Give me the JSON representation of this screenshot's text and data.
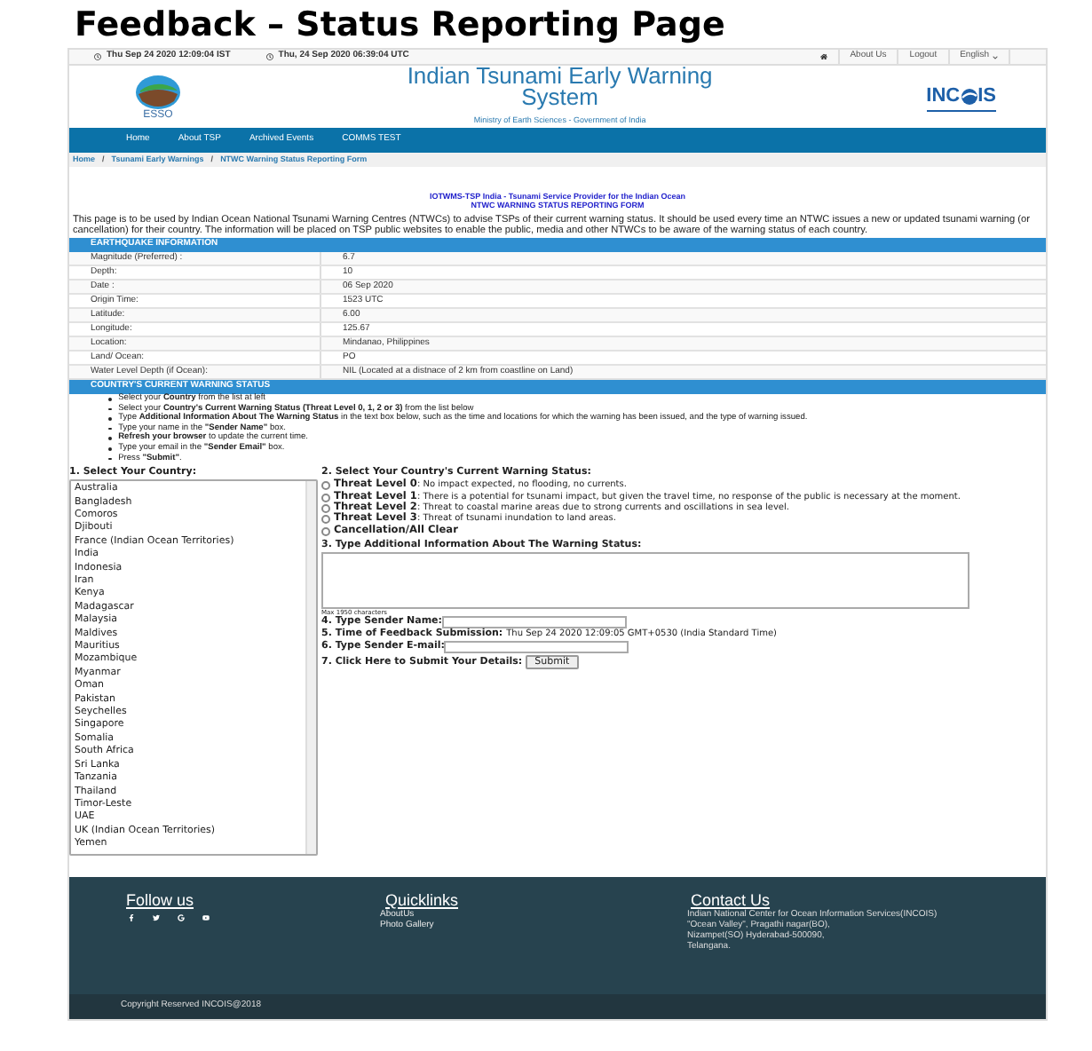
{
  "slide_title": "Feedback – Status Reporting Page",
  "top_bar": {
    "local_time": "Thu Sep 24 2020 12:09:04 IST",
    "utc_time": "Thu, 24 Sep 2020 06:39:04 UTC",
    "links": [
      "About Us",
      "Logout"
    ],
    "language": "English"
  },
  "header": {
    "left_logo_label": "ESSO",
    "title": "Indian Tsunami Early Warning System",
    "subtitle": "Ministry of Earth Sciences - Government of India",
    "right_logo_start": "INC",
    "right_logo_end": "IS"
  },
  "nav": [
    "Home",
    "About TSP",
    "Archived Events",
    "COMMS TEST"
  ],
  "breadcrumb": [
    {
      "label": "Home"
    },
    {
      "separator": "/",
      "label": "Tsunami Early Warnings"
    },
    {
      "separator": "/",
      "label": "NTWC Warning Status Reporting Form"
    }
  ],
  "form_heading": [
    "IOTWMS-TSP India - Tsunami Service Provider for the Indian Ocean",
    "NTWC WARNING STATUS REPORTING FORM"
  ],
  "intro": "This page is to be used by Indian Ocean National Tsunami Warning Centres (NTWCs) to advise TSPs of their current warning status. It should be used every time an NTWC issues a new or updated tsunami warning (or cancellation) for their country. The information will be placed on TSP public websites to enable the public, media and other NTWCs to be aware of the warning status of each country.",
  "earthquake": {
    "heading": "EARTHQUAKE INFORMATION",
    "rows": [
      {
        "label": "Magnitude (Preferred) :",
        "value": "6.7"
      },
      {
        "label": "Depth:",
        "value": "10"
      },
      {
        "label": "Date :",
        "value": "06 Sep 2020"
      },
      {
        "label": "Origin Time:",
        "value": "1523 UTC"
      },
      {
        "label": "Latitude:",
        "value": "6.00"
      },
      {
        "label": "Longitude:",
        "value": "125.67"
      },
      {
        "label": "Location:",
        "value": "Mindanao, Philippines"
      },
      {
        "label": "Land/ Ocean:",
        "value": "PO"
      },
      {
        "label": "Water Level Depth (if Ocean):",
        "value": "NIL (Located at a distnace of 2 km from coastline on Land)"
      }
    ]
  },
  "status": {
    "heading": "COUNTRY'S CURRENT WARNING STATUS",
    "instructions": [
      "Select your **Country** from the list at left",
      "Select your **Country's Current Warning Status (Threat Level 0, 1, 2 or 3)** from the list below",
      "Type **Additional Information About The Warning Status** in the text box below, such as the time and locations for which the warning has been issued, and the type of warning issued.",
      "Type your name in the **\"Sender Name\"** box.",
      "**Refresh your browser** to update the current time.",
      "Type your email in the **\"Sender Email\"** box.",
      "Press **\"Submit\"**."
    ]
  },
  "country_select": {
    "label": "1. Select Your Country:",
    "options": [
      {
        "name": "Australia",
        "selected": false
      },
      {
        "name": "Bangladesh",
        "selected": false
      },
      {
        "name": "Comoros",
        "selected": false
      },
      {
        "name": "Djibouti",
        "selected": false
      },
      {
        "name": "France (Indian Ocean Territories)",
        "selected": false
      },
      {
        "name": "India",
        "selected": false
      },
      {
        "name": "Indonesia",
        "selected": false
      },
      {
        "name": "Iran",
        "selected": false
      },
      {
        "name": "Kenya",
        "selected": false
      },
      {
        "name": "Madagascar",
        "selected": false
      },
      {
        "name": "Malaysia",
        "selected": false
      },
      {
        "name": "Maldives",
        "selected": false
      },
      {
        "name": "Mauritius",
        "selected": false
      },
      {
        "name": "Mozambique",
        "selected": false
      },
      {
        "name": "Myanmar",
        "selected": false
      },
      {
        "name": "Oman",
        "selected": false
      },
      {
        "name": "Pakistan",
        "selected": false
      },
      {
        "name": "Seychelles",
        "selected": false
      },
      {
        "name": "Singapore",
        "selected": false
      },
      {
        "name": "Somalia",
        "selected": false
      },
      {
        "name": "South Africa",
        "selected": false
      },
      {
        "name": "Sri Lanka",
        "selected": false
      },
      {
        "name": "Tanzania",
        "selected": false
      },
      {
        "name": "Thailand",
        "selected": false
      },
      {
        "name": "Timor-Leste",
        "selected": false
      },
      {
        "name": "UAE",
        "selected": false
      },
      {
        "name": "UK (Indian Ocean Territories)",
        "selected": false
      },
      {
        "name": "Yemen",
        "selected": false
      }
    ]
  },
  "warning_status": {
    "label": "2. Select Your Country's Current Warning Status:",
    "options": [
      {
        "title": "Threat Level 0",
        "description": ": No impact expected, no flooding, no currents.",
        "selected": false
      },
      {
        "title": "Threat Level 1",
        "description": ": There is a potential for tsunami impact, but given the travel time, no response of the public is necessary at the moment.",
        "selected": false
      },
      {
        "title": "Threat Level 2",
        "description": ": Threat to coastal marine areas due to strong currents and oscillations in sea level.",
        "selected": false
      },
      {
        "title": "Threat Level 3",
        "description": ": Threat of tsunami inundation to land areas.",
        "selected": false
      },
      {
        "title": "Cancellation/All Clear",
        "selected": false
      }
    ]
  },
  "additional_info": {
    "label": "3. Type Additional Information About The Warning Status:",
    "hint": "Max 1950 characters"
  },
  "sender_name": {
    "label": "4. Type Sender Name:"
  },
  "submission_time": {
    "label": "5. Time of Feedback Submission:",
    "value": "Thu Sep 24 2020 12:09:05 GMT+0530 (India Standard Time)"
  },
  "sender_email": {
    "label": "6. Type Sender E-mail:"
  },
  "submit": {
    "label": "7. Click Here to Submit Your Details:",
    "button": "Submit"
  },
  "footer": {
    "follow_heading": "Follow us",
    "quicklinks_heading": "Quicklinks",
    "quicklinks": [
      "AboutUs",
      "Photo Gallery"
    ],
    "contact_heading": "Contact Us",
    "contact_lines": [
      "Indian National Center for Ocean Information Services(INCOIS)",
      "\"Ocean Valley\", Pragathi nagar(BO),",
      "Nizampet(SO) Hyderabad-500090,",
      "Telangana."
    ],
    "copyright": "Copyright Reserved INCOIS@2018"
  }
}
